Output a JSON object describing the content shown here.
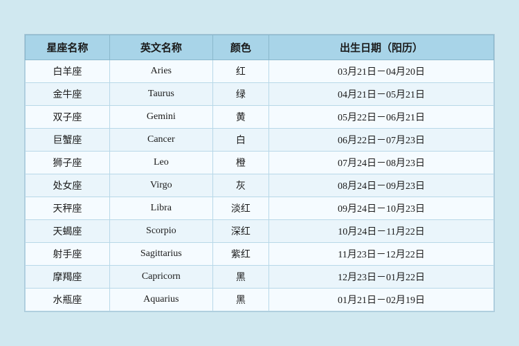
{
  "table": {
    "headers": [
      "星座名称",
      "英文名称",
      "颜色",
      "出生日期（阳历）"
    ],
    "rows": [
      {
        "chinese": "白羊座",
        "english": "Aries",
        "color": "红",
        "date": "03月21日－04月20日"
      },
      {
        "chinese": "金牛座",
        "english": "Taurus",
        "color": "绿",
        "date": "04月21日－05月21日"
      },
      {
        "chinese": "双子座",
        "english": "Gemini",
        "color": "黄",
        "date": "05月22日－06月21日"
      },
      {
        "chinese": "巨蟹座",
        "english": "Cancer",
        "color": "白",
        "date": "06月22日－07月23日"
      },
      {
        "chinese": "狮子座",
        "english": "Leo",
        "color": "橙",
        "date": "07月24日－08月23日"
      },
      {
        "chinese": "处女座",
        "english": "Virgo",
        "color": "灰",
        "date": "08月24日－09月23日"
      },
      {
        "chinese": "天秤座",
        "english": "Libra",
        "color": "淡红",
        "date": "09月24日－10月23日"
      },
      {
        "chinese": "天蝎座",
        "english": "Scorpio",
        "color": "深红",
        "date": "10月24日－11月22日"
      },
      {
        "chinese": "射手座",
        "english": "Sagittarius",
        "color": "紫红",
        "date": "11月23日－12月22日"
      },
      {
        "chinese": "摩羯座",
        "english": "Capricorn",
        "color": "黑",
        "date": "12月23日－01月22日"
      },
      {
        "chinese": "水瓶座",
        "english": "Aquarius",
        "color": "黑",
        "date": "01月21日－02月19日"
      }
    ]
  }
}
